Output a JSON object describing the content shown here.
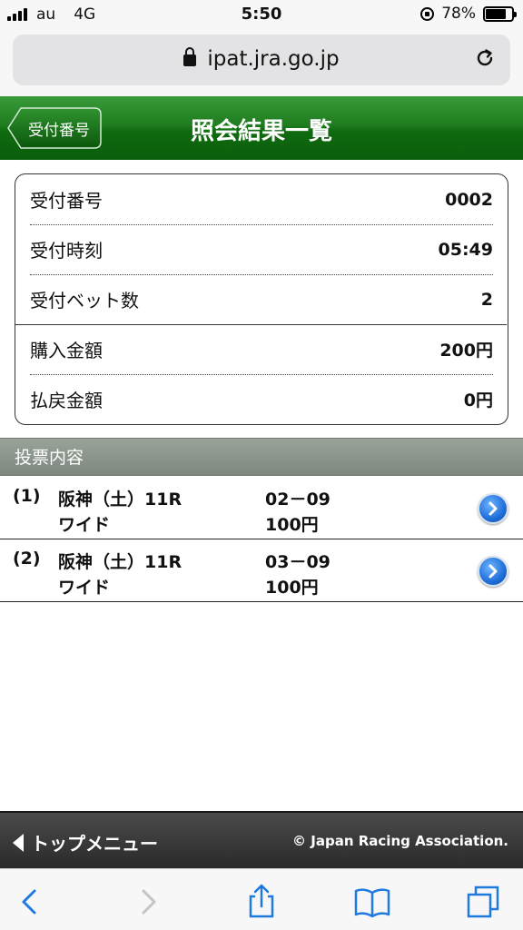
{
  "status_bar": {
    "carrier": "au",
    "network": "4G",
    "time": "5:50",
    "battery_percent": "78%",
    "battery_level": 0.78
  },
  "browser": {
    "url": "ipat.jra.go.jp"
  },
  "header": {
    "back_label": "受付番号",
    "title": "照会結果一覧",
    "color": "#1f7d1f"
  },
  "receipt": {
    "rows": [
      {
        "label": "受付番号",
        "value": "0002"
      },
      {
        "label": "受付時刻",
        "value": "05:49"
      },
      {
        "label": "受付ベット数",
        "value": "2"
      },
      {
        "label": "購入金額",
        "value": "200円"
      },
      {
        "label": "払戻金額",
        "value": "0円"
      }
    ]
  },
  "bets": {
    "section_title": "投票内容",
    "items": [
      {
        "number": "(1)",
        "race": "阪神（土）11R",
        "type": "ワイド",
        "combination": "02－09",
        "amount": "100円"
      },
      {
        "number": "(2)",
        "race": "阪神（土）11R",
        "type": "ワイド",
        "combination": "03－09",
        "amount": "100円"
      }
    ]
  },
  "footer": {
    "top_menu_label": "トップメニュー",
    "copyright": "© Japan Racing Association."
  },
  "toolbar": {
    "icons": [
      "back-icon",
      "forward-icon",
      "share-icon",
      "bookmarks-icon",
      "tabs-icon"
    ],
    "accent": "#1f7ae0"
  }
}
